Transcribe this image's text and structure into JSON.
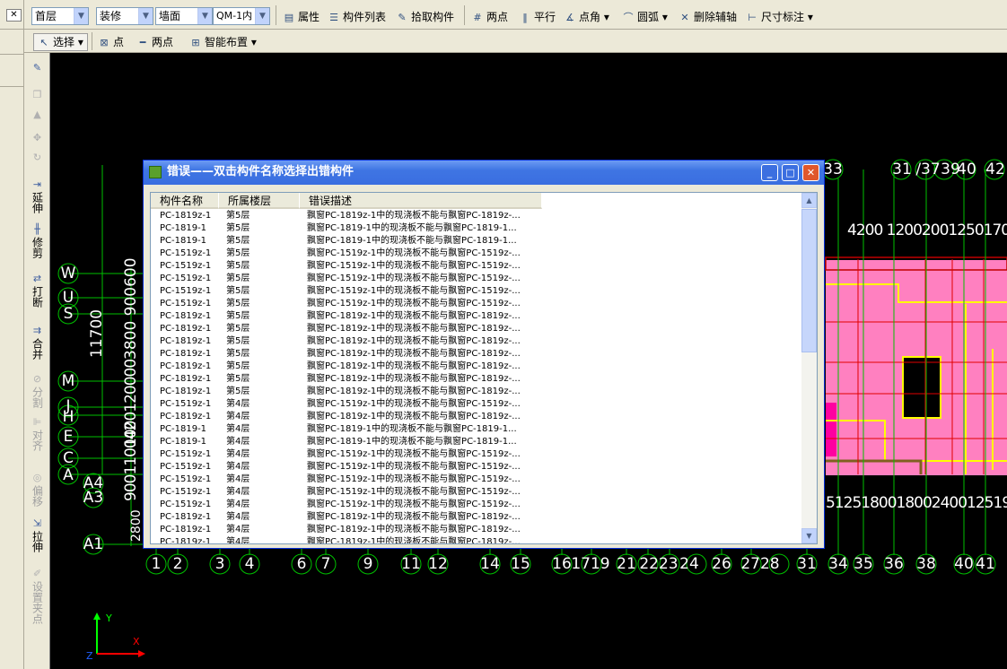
{
  "app": {
    "toolbar1": {
      "close_glyph": "✕",
      "floor": "首层",
      "category": "装修",
      "component_type": "墙面",
      "component": "QM-1内",
      "buttons": [
        {
          "label": "属性",
          "icon": "properties-icon"
        },
        {
          "label": "构件列表",
          "icon": "list-icon"
        },
        {
          "label": "拾取构件",
          "icon": "pick-icon"
        },
        {
          "label": "两点",
          "icon": "two-point-axis-icon"
        },
        {
          "label": "平行",
          "icon": "parallel-icon"
        },
        {
          "label": "点角",
          "icon": "point-angle-icon"
        },
        {
          "label": "圆弧",
          "icon": "arc-icon"
        },
        {
          "label": "删除辅轴",
          "icon": "delete-axis-icon"
        },
        {
          "label": "尺寸标注",
          "icon": "dimension-icon"
        }
      ]
    },
    "toolbar2": {
      "buttons": [
        {
          "label": "选择",
          "icon": "select-arrow-icon"
        },
        {
          "label": "点",
          "icon": "point-icon"
        },
        {
          "label": "两点",
          "icon": "two-point-icon"
        },
        {
          "label": "智能布置",
          "icon": "smart-layout-icon"
        }
      ]
    },
    "left_tools": [
      {
        "label": "延伸",
        "icon": "extend-icon"
      },
      {
        "label": "修剪",
        "icon": "trim-icon"
      },
      {
        "label": "打断",
        "icon": "break-icon"
      },
      {
        "label": "合并",
        "icon": "merge-icon"
      },
      {
        "label": "分割",
        "icon": "split-icon"
      },
      {
        "label": "对齐",
        "icon": "align-icon"
      },
      {
        "label": "偏移",
        "icon": "offset-icon"
      },
      {
        "label": "拉伸",
        "icon": "stretch-icon"
      },
      {
        "label": "设置夹点",
        "icon": "grip-icon"
      }
    ]
  },
  "dialog": {
    "title": "错误——双击构件名称选择出错构件",
    "columns": [
      "构件名称",
      "所属楼层",
      "错误描述"
    ],
    "rows": [
      {
        "name": "PC-1819z-1",
        "floor": "第5层",
        "desc": "飘窗PC-1819z-1中的现浇板不能与飘窗PC-1819z-..."
      },
      {
        "name": "PC-1819-1",
        "floor": "第5层",
        "desc": "飘窗PC-1819-1中的现浇板不能与飘窗PC-1819-1..."
      },
      {
        "name": "PC-1819-1",
        "floor": "第5层",
        "desc": "飘窗PC-1819-1中的现浇板不能与飘窗PC-1819-1..."
      },
      {
        "name": "PC-1519z-1",
        "floor": "第5层",
        "desc": "飘窗PC-1519z-1中的现浇板不能与飘窗PC-1519z-..."
      },
      {
        "name": "PC-1519z-1",
        "floor": "第5层",
        "desc": "飘窗PC-1519z-1中的现浇板不能与飘窗PC-1519z-..."
      },
      {
        "name": "PC-1519z-1",
        "floor": "第5层",
        "desc": "飘窗PC-1519z-1中的现浇板不能与飘窗PC-1519z-..."
      },
      {
        "name": "PC-1519z-1",
        "floor": "第5层",
        "desc": "飘窗PC-1519z-1中的现浇板不能与飘窗PC-1519z-..."
      },
      {
        "name": "PC-1519z-1",
        "floor": "第5层",
        "desc": "飘窗PC-1519z-1中的现浇板不能与飘窗PC-1519z-..."
      },
      {
        "name": "PC-1819z-1",
        "floor": "第5层",
        "desc": "飘窗PC-1819z-1中的现浇板不能与飘窗PC-1819z-..."
      },
      {
        "name": "PC-1819z-1",
        "floor": "第5层",
        "desc": "飘窗PC-1819z-1中的现浇板不能与飘窗PC-1819z-..."
      },
      {
        "name": "PC-1819z-1",
        "floor": "第5层",
        "desc": "飘窗PC-1819z-1中的现浇板不能与飘窗PC-1819z-..."
      },
      {
        "name": "PC-1819z-1",
        "floor": "第5层",
        "desc": "飘窗PC-1819z-1中的现浇板不能与飘窗PC-1819z-..."
      },
      {
        "name": "PC-1819z-1",
        "floor": "第5层",
        "desc": "飘窗PC-1819z-1中的现浇板不能与飘窗PC-1819z-..."
      },
      {
        "name": "PC-1819z-1",
        "floor": "第5层",
        "desc": "飘窗PC-1819z-1中的现浇板不能与飘窗PC-1819z-..."
      },
      {
        "name": "PC-1819z-1",
        "floor": "第5层",
        "desc": "飘窗PC-1819z-1中的现浇板不能与飘窗PC-1819z-..."
      },
      {
        "name": "PC-1519z-1",
        "floor": "第4层",
        "desc": "飘窗PC-1519z-1中的现浇板不能与飘窗PC-1519z-..."
      },
      {
        "name": "PC-1819z-1",
        "floor": "第4层",
        "desc": "飘窗PC-1819z-1中的现浇板不能与飘窗PC-1819z-..."
      },
      {
        "name": "PC-1819-1",
        "floor": "第4层",
        "desc": "飘窗PC-1819-1中的现浇板不能与飘窗PC-1819-1..."
      },
      {
        "name": "PC-1819-1",
        "floor": "第4层",
        "desc": "飘窗PC-1819-1中的现浇板不能与飘窗PC-1819-1..."
      },
      {
        "name": "PC-1519z-1",
        "floor": "第4层",
        "desc": "飘窗PC-1519z-1中的现浇板不能与飘窗PC-1519z-..."
      },
      {
        "name": "PC-1519z-1",
        "floor": "第4层",
        "desc": "飘窗PC-1519z-1中的现浇板不能与飘窗PC-1519z-..."
      },
      {
        "name": "PC-1519z-1",
        "floor": "第4层",
        "desc": "飘窗PC-1519z-1中的现浇板不能与飘窗PC-1519z-..."
      },
      {
        "name": "PC-1519z-1",
        "floor": "第4层",
        "desc": "飘窗PC-1519z-1中的现浇板不能与飘窗PC-1519z-..."
      },
      {
        "name": "PC-1519z-1",
        "floor": "第4层",
        "desc": "飘窗PC-1519z-1中的现浇板不能与飘窗PC-1519z-..."
      },
      {
        "name": "PC-1819z-1",
        "floor": "第4层",
        "desc": "飘窗PC-1819z-1中的现浇板不能与飘窗PC-1819z-..."
      },
      {
        "name": "PC-1819z-1",
        "floor": "第4层",
        "desc": "飘窗PC-1819z-1中的现浇板不能与飘窗PC-1819z-..."
      },
      {
        "name": "PC-1819z-1",
        "floor": "第4层",
        "desc": "飘窗PC-1819z-1中的现浇板不能与飘窗PC-1819z-..."
      }
    ]
  },
  "drawing": {
    "bottom_axes": [
      "1",
      "2",
      "3",
      "4",
      "6",
      "7",
      "9",
      "11",
      "12",
      "14",
      "15",
      "16",
      "1719",
      "21",
      "2223",
      "24",
      "26",
      "2728",
      "31",
      "34",
      "35",
      "36",
      "38",
      "40",
      "41"
    ],
    "top_axes": [
      "33",
      "31",
      "/37",
      "39",
      "40",
      "42"
    ],
    "left_axes": [
      "W",
      "U",
      "S",
      "M",
      "J",
      "H",
      "E",
      "C",
      "A",
      "A4",
      "A3",
      "A1"
    ],
    "dim_top_right": "4200 1200200125017002",
    "dim_bottom_right": "5125180018002400125195",
    "dim_left_vertical": "11700",
    "dim_left_vertical2": "3800 900600",
    "dim_left_vertical3": "1000120000",
    "dim_left_vertical4": "900110042",
    "dim_left_vertical5": "2800",
    "ucs": {
      "x": "X",
      "y": "Y",
      "z": "Z"
    }
  }
}
